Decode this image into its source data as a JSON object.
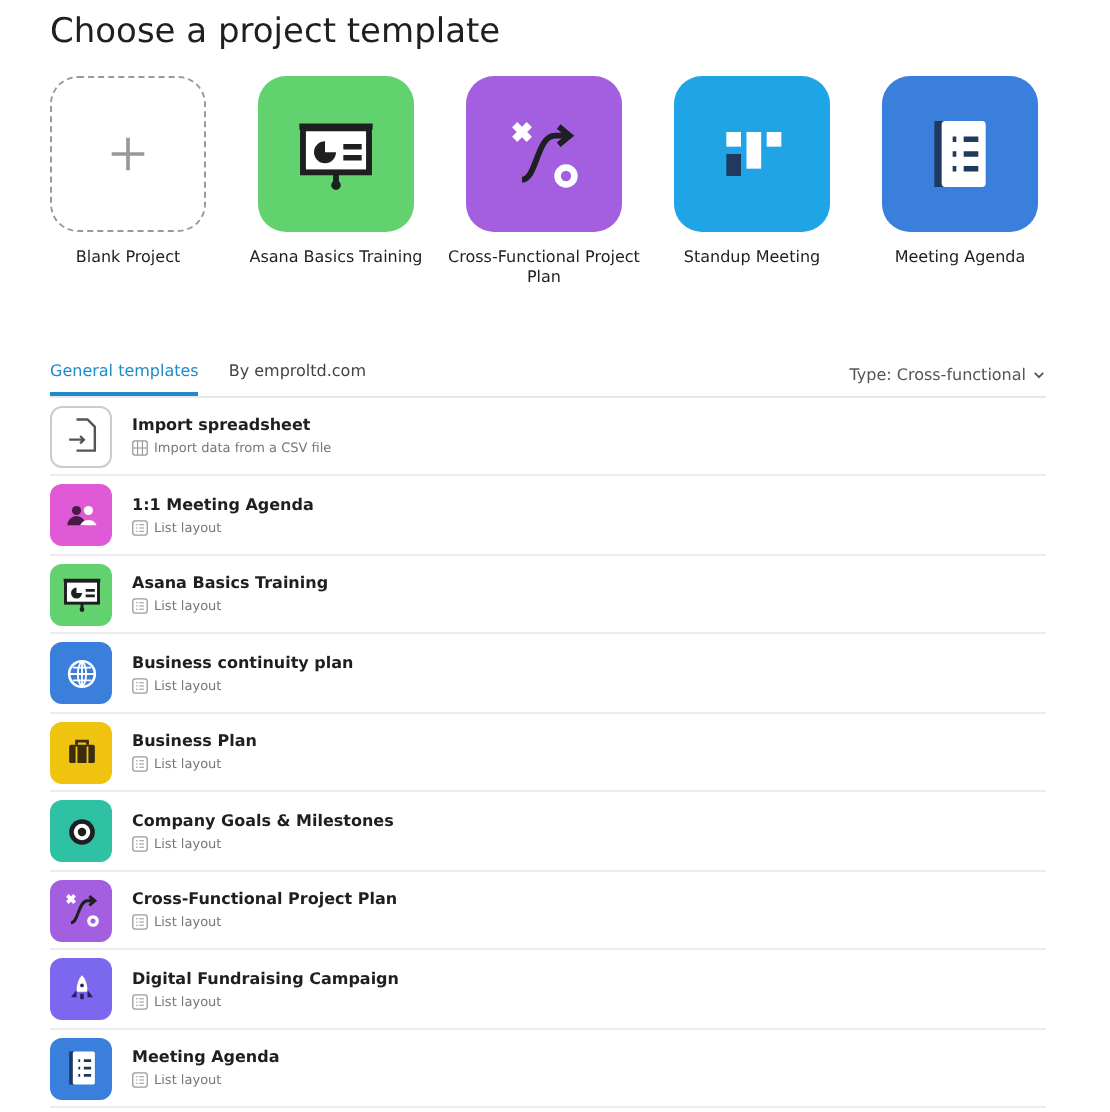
{
  "title": "Choose a project template",
  "featured": [
    {
      "label": "Blank Project",
      "kind": "blank"
    },
    {
      "label": "Asana Basics Training",
      "kind": "presentation",
      "color": "#62d26f"
    },
    {
      "label": "Cross-Functional Project Plan",
      "kind": "crossfunc",
      "color": "#a35fe0"
    },
    {
      "label": "Standup Meeting",
      "kind": "standup",
      "color": "#1fa5e6"
    },
    {
      "label": "Meeting Agenda",
      "kind": "agenda",
      "color": "#3b7fdc"
    }
  ],
  "tabs": [
    {
      "label": "General templates",
      "selected": true
    },
    {
      "label": "By emproltd.com",
      "selected": false
    }
  ],
  "type_filter": "Type: Cross-functional",
  "templates": [
    {
      "name": "Import spreadsheet",
      "kind": "import",
      "layout": {
        "kind": "grid",
        "text": "Import data from a CSV file"
      }
    },
    {
      "name": "1:1 Meeting Agenda",
      "kind": "people",
      "color": "#e05ad8",
      "layout": {
        "kind": "list",
        "text": "List layout"
      }
    },
    {
      "name": "Asana Basics Training",
      "kind": "presentation",
      "color": "#62d26f",
      "layout": {
        "kind": "list",
        "text": "List layout"
      }
    },
    {
      "name": "Business continuity plan",
      "kind": "globe",
      "color": "#3b7fdc",
      "layout": {
        "kind": "list",
        "text": "List layout"
      }
    },
    {
      "name": "Business Plan",
      "kind": "briefcase",
      "color": "#f0c30e",
      "layout": {
        "kind": "list",
        "text": "List layout"
      }
    },
    {
      "name": "Company Goals & Milestones",
      "kind": "target",
      "color": "#2fc1a4",
      "layout": {
        "kind": "list",
        "text": "List layout"
      }
    },
    {
      "name": "Cross-Functional Project Plan",
      "kind": "crossfunc",
      "color": "#a35fe0",
      "layout": {
        "kind": "list",
        "text": "List layout"
      }
    },
    {
      "name": "Digital Fundraising Campaign",
      "kind": "rocket",
      "color": "#7b68ee",
      "layout": {
        "kind": "list",
        "text": "List layout"
      }
    },
    {
      "name": "Meeting Agenda",
      "kind": "agenda",
      "color": "#3b7fdc",
      "layout": {
        "kind": "list",
        "text": "List layout"
      }
    }
  ]
}
